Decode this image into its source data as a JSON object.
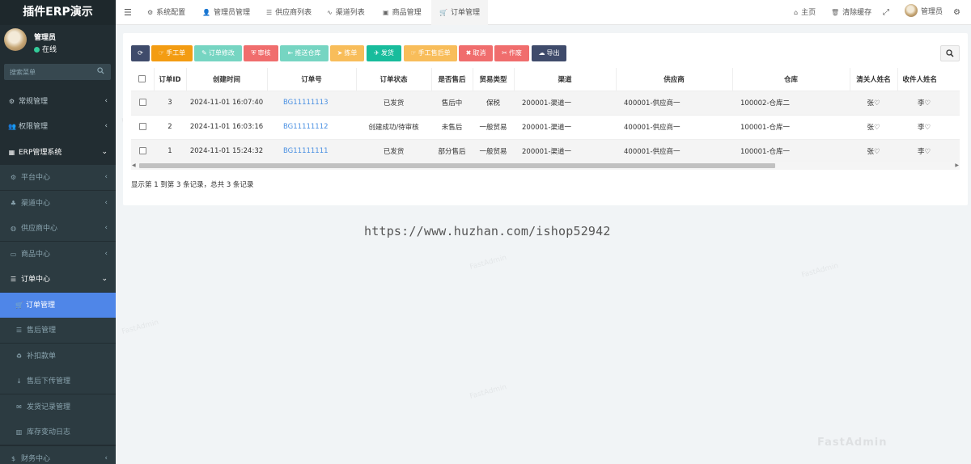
{
  "app": {
    "title": "插件ERP演示"
  },
  "user": {
    "name": "管理员",
    "status": "在线"
  },
  "sidebar": {
    "search_placeholder": "搜索菜单",
    "items": [
      {
        "label": "常规管理",
        "icon": "cogs-icon"
      },
      {
        "label": "权限管理",
        "icon": "group-icon"
      },
      {
        "label": "ERP管理系统",
        "icon": "table-icon"
      },
      {
        "label": "平台中心",
        "icon": "gear-icon"
      },
      {
        "label": "渠道中心",
        "icon": "sitemap-icon"
      },
      {
        "label": "供应商中心",
        "icon": "globe-icon"
      },
      {
        "label": "商品中心",
        "icon": "inbox-icon"
      },
      {
        "label": "订单中心",
        "icon": "list-icon"
      },
      {
        "label": "订单管理",
        "icon": "cart-icon"
      },
      {
        "label": "售后管理",
        "icon": "list-icon"
      },
      {
        "label": "补扣款单",
        "icon": "recycle-icon"
      },
      {
        "label": "售后下传管理",
        "icon": "arrow-down-icon"
      },
      {
        "label": "发货记录管理",
        "icon": "envelope-icon"
      },
      {
        "label": "库存变动日志",
        "icon": "bar-chart-icon"
      },
      {
        "label": "财务中心",
        "icon": "money-icon"
      }
    ]
  },
  "topnav": {
    "tabs": [
      {
        "label": "系统配置",
        "icon": "gear-icon"
      },
      {
        "label": "管理员管理",
        "icon": "user-icon"
      },
      {
        "label": "供应商列表",
        "icon": "list-icon"
      },
      {
        "label": "渠道列表",
        "icon": "link-icon"
      },
      {
        "label": "商品管理",
        "icon": "box-icon"
      },
      {
        "label": "订单管理",
        "icon": "cart-icon"
      }
    ],
    "home": "主页",
    "clear_cache": "清除缓存",
    "admin": "管理员"
  },
  "toolbar": {
    "buttons": [
      {
        "label": "",
        "icon": "refresh-icon",
        "color": "#3f4b6b"
      },
      {
        "label": "手工单",
        "icon": "hand-icon",
        "color": "#f39c12"
      },
      {
        "label": "订单修改",
        "icon": "pencil-icon",
        "color": "#76d5c2"
      },
      {
        "label": "审核",
        "icon": "shield-icon",
        "color": "#f06d6d"
      },
      {
        "label": "推送仓库",
        "icon": "push-icon",
        "color": "#76d5c2"
      },
      {
        "label": "拣单",
        "icon": "send-icon",
        "color": "#f8bd5a"
      },
      {
        "label": "发货",
        "icon": "twitter-icon",
        "color": "#18bc9c"
      },
      {
        "label": "手工售后单",
        "icon": "hand-icon",
        "color": "#f8bd5a"
      },
      {
        "label": "取消",
        "icon": "close-icon",
        "color": "#f06d6d"
      },
      {
        "label": "作废",
        "icon": "scissors-icon",
        "color": "#f06d6d"
      },
      {
        "label": "导出",
        "icon": "download-icon",
        "color": "#3f4b6b"
      }
    ]
  },
  "table": {
    "columns": [
      "订单ID",
      "创建时间",
      "订单号",
      "订单状态",
      "是否售后",
      "贸易类型",
      "渠道",
      "供应商",
      "仓库",
      "清关人姓名",
      "收件人姓名"
    ],
    "rows": [
      [
        "3",
        "2024-11-01 16:07:40",
        "BG11111113",
        "已发货",
        "售后中",
        "保税",
        "200001-渠道一",
        "400001-供应商一",
        "100002-仓库二",
        "张♡",
        "李♡"
      ],
      [
        "2",
        "2024-11-01 16:03:16",
        "BG11111112",
        "创建成功/待审核",
        "未售后",
        "一般贸易",
        "200001-渠道一",
        "400001-供应商一",
        "100001-仓库一",
        "张♡",
        "李♡"
      ],
      [
        "1",
        "2024-11-01 15:24:32",
        "BG11111111",
        "已发货",
        "部分售后",
        "一般贸易",
        "200001-渠道一",
        "400001-供应商一",
        "100001-仓库一",
        "张♡",
        "李♡"
      ]
    ]
  },
  "pagination": {
    "info": "显示第 1 到第 3 条记录，总共 3 条记录"
  },
  "watermark": {
    "url": "https://www.huzhan.com/ishop52942",
    "brand": "FastAdmin"
  }
}
